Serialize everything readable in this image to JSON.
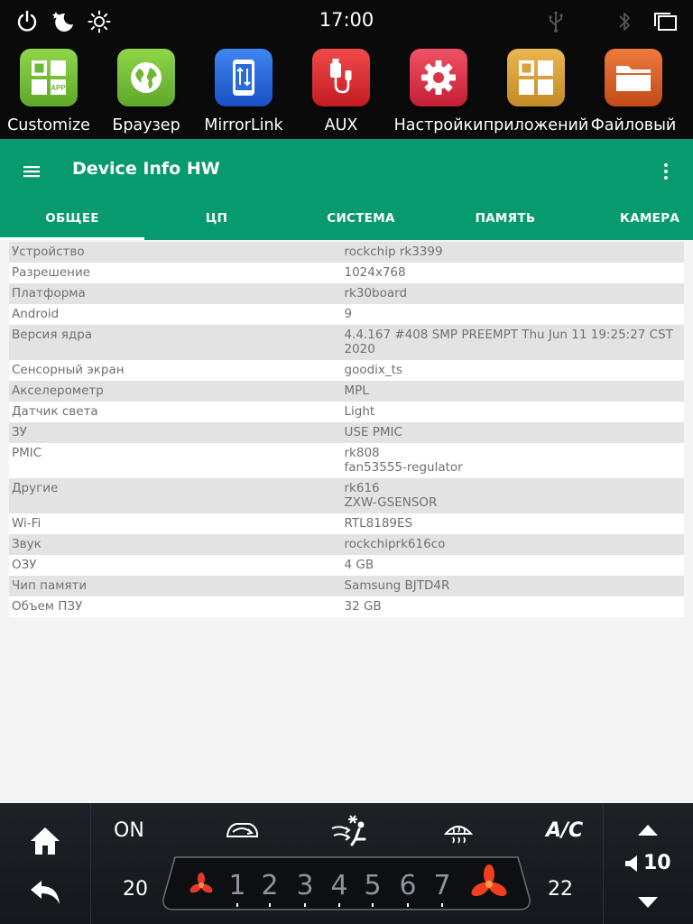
{
  "status_bar": {
    "time": "17:00",
    "icons": [
      "power-icon",
      "moon-icon",
      "brightness-icon",
      "usb-icon",
      "bluetooth-icon",
      "recent-apps-icon"
    ]
  },
  "launcher": {
    "apps": [
      {
        "label": "Customize",
        "icon": "app-grid-icon",
        "color": "#7cc23a"
      },
      {
        "label": "Браузер",
        "icon": "globe-icon",
        "color": "#7cc23a"
      },
      {
        "label": "MirrorLink",
        "icon": "phone-link-icon",
        "color": "#2a6bdc"
      },
      {
        "label": "AUX",
        "icon": "aux-plug-icon",
        "color": "#e13035"
      },
      {
        "label": "Настройки",
        "icon": "gear-icon",
        "color": "#dc3446"
      },
      {
        "label": "приложений",
        "icon": "app-grid-icon",
        "color": "#d9a23b"
      },
      {
        "label": "Файловый",
        "icon": "folder-icon",
        "color": "#d9622b"
      }
    ]
  },
  "app_bar": {
    "title": "Device Info HW",
    "accent_color": "#069a6e",
    "tabs": [
      {
        "label": "ОБЩЕЕ",
        "active": true
      },
      {
        "label": "ЦП",
        "active": false
      },
      {
        "label": "СИСТЕМА",
        "active": false
      },
      {
        "label": "ПАМЯТЬ",
        "active": false
      },
      {
        "label": "КАМЕРА",
        "active": false
      }
    ]
  },
  "info_rows": [
    {
      "key": "Устройство",
      "value": "rockchip rk3399"
    },
    {
      "key": "Разрешение",
      "value": "1024x768"
    },
    {
      "key": "Платформа",
      "value": "rk30board"
    },
    {
      "key": "Android",
      "value": "9"
    },
    {
      "key": "Версия ядра",
      "value": "4.4.167 #408 SMP PREEMPT Thu Jun 11 19:25:27 CST 2020"
    },
    {
      "key": "Сенсорный экран",
      "value": "goodix_ts"
    },
    {
      "key": "Акселерометр",
      "value": "MPL"
    },
    {
      "key": "Датчик света",
      "value": "Light"
    },
    {
      "key": "ЗУ",
      "value": "USE PMIC"
    },
    {
      "key": "PMIC",
      "value": "rk808\nfan53555-regulator"
    },
    {
      "key": "Другие",
      "value": "rk616\nZXW-GSENSOR"
    },
    {
      "key": "Wi-Fi",
      "value": "RTL8189ES"
    },
    {
      "key": "Звук",
      "value": "rockchiprk616co"
    },
    {
      "key": "ОЗУ",
      "value": "4 GB"
    },
    {
      "key": "Чип памяти",
      "value": "Samsung BJTD4R"
    },
    {
      "key": "Объем ПЗУ",
      "value": "32 GB"
    }
  ],
  "climate": {
    "power": "ON",
    "ac": "A/C",
    "left_temp": "20",
    "right_temp": "22",
    "fan_speeds": [
      "1",
      "2",
      "3",
      "4",
      "5",
      "6",
      "7"
    ]
  },
  "volume": {
    "level": "10"
  }
}
